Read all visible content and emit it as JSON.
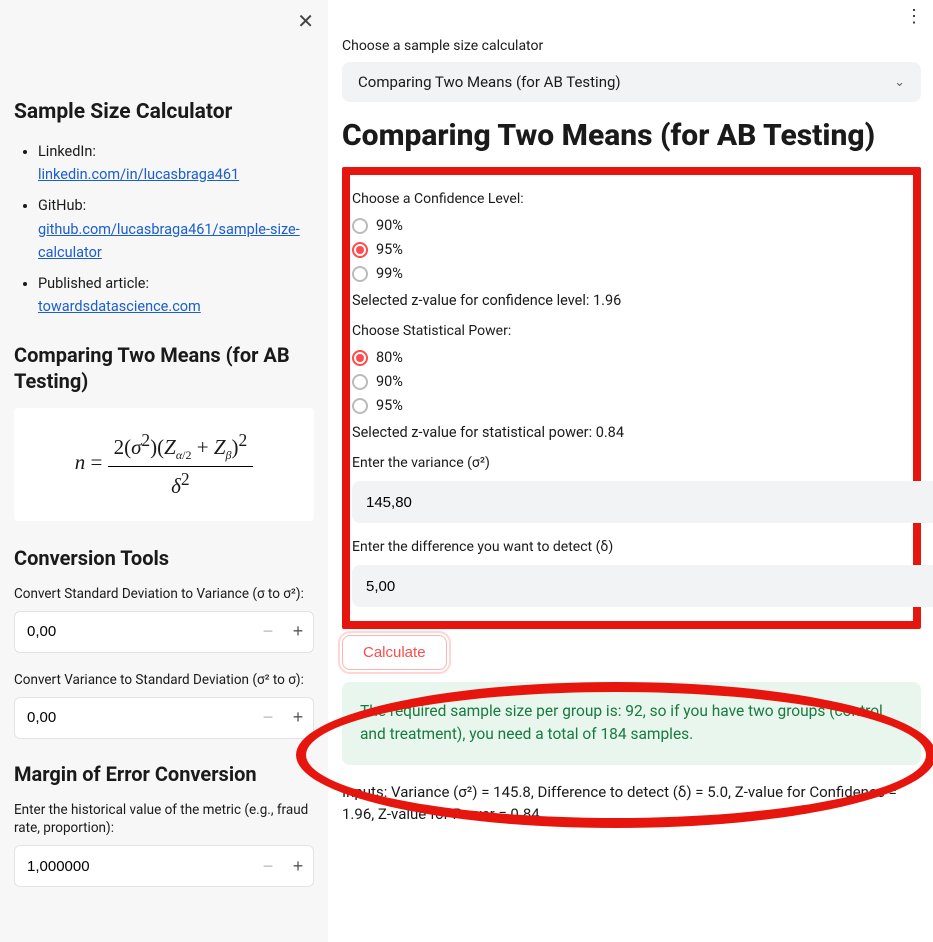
{
  "sidebar": {
    "title": "Sample Size Calculator",
    "links": {
      "linkedin_label": "LinkedIn:",
      "linkedin_url": "linkedin.com/in/lucasbraga461",
      "github_label": "GitHub:",
      "github_url": "github.com/lucasbraga461/sample-size-calculator",
      "article_label": "Published article:",
      "article_url": "towardsdatascience.com"
    },
    "section_heading": "Comparing Two Means (for AB Testing)",
    "formula": {
      "lhs": "n =",
      "numerator": "2(σ²)(Z",
      "sub1": "α/2",
      "plus": " + Z",
      "sub2": "β",
      "close_sq": ")²",
      "denominator": "δ²"
    },
    "conversion_heading": "Conversion Tools",
    "conv_sd_to_var_label": "Convert Standard Deviation to Variance (σ to σ²):",
    "conv_sd_to_var_value": "0,00",
    "conv_var_to_sd_label": "Convert Variance to Standard Deviation (σ² to σ):",
    "conv_var_to_sd_value": "0,00",
    "margin_heading": "Margin of Error Conversion",
    "margin_label": "Enter the historical value of the metric (e.g., fraud rate, proportion):",
    "margin_value": "1,000000"
  },
  "main": {
    "chooser_label": "Choose a sample size calculator",
    "dropdown_value": "Comparing Two Means (for AB Testing)",
    "heading": "Comparing Two Means (for AB Testing)",
    "confidence_label": "Choose a Confidence Level:",
    "confidence_options": [
      "90%",
      "95%",
      "99%"
    ],
    "confidence_selected_index": 1,
    "confidence_z_text": "Selected z-value for confidence level: 1.96",
    "power_label": "Choose Statistical Power:",
    "power_options": [
      "80%",
      "90%",
      "95%"
    ],
    "power_selected_index": 0,
    "power_z_text": "Selected z-value for statistical power: 0.84",
    "variance_label": "Enter the variance (σ²)",
    "variance_value": "145,80",
    "delta_label": "Enter the difference you want to detect (δ)",
    "delta_value": "5,00",
    "calculate_label": "Calculate",
    "result_text": "The required sample size per group is: 92, so if you have two groups (control and treatment), you need a total of 184 samples.",
    "inputs_summary": "Inputs: Variance (σ²) = 145.8, Difference to detect (δ) = 5.0, Z-value for Confidence = 1.96, Z-value for Power = 0.84"
  }
}
